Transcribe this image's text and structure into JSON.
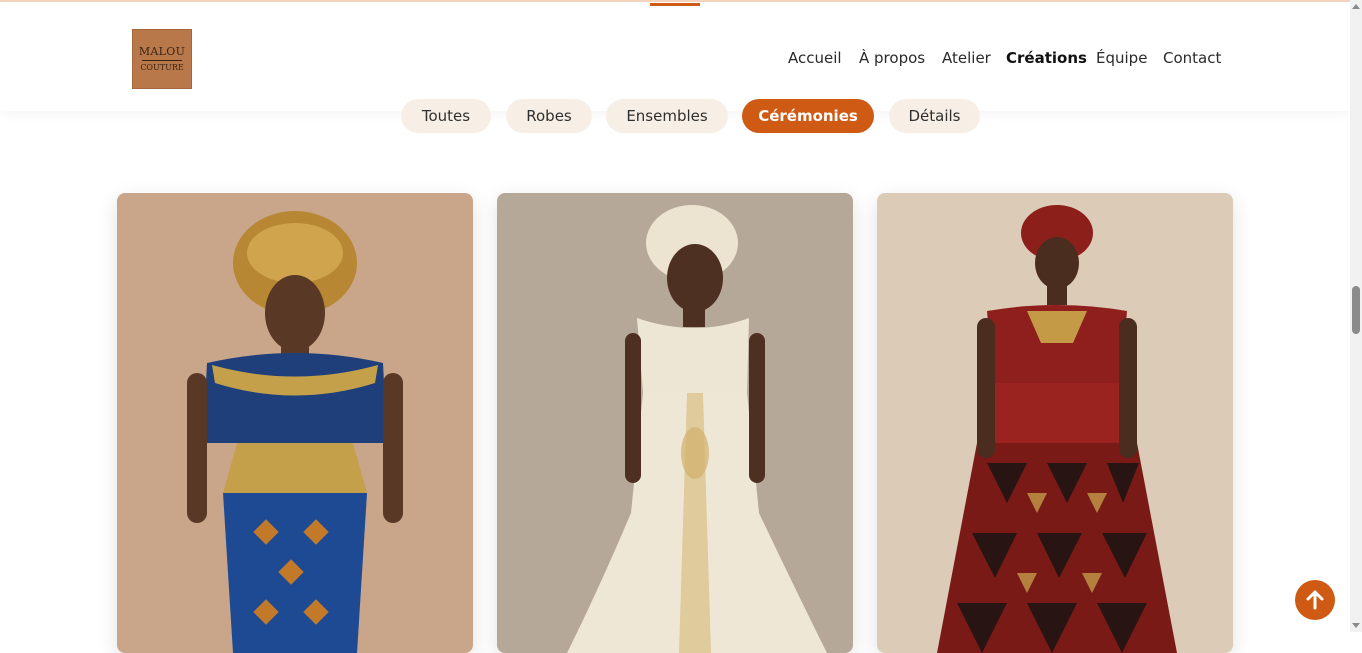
{
  "logo": {
    "line1": "MALOU",
    "line2": "COUTURE",
    "alt": "Malou Couture"
  },
  "nav": {
    "items": [
      {
        "label": "Accueil"
      },
      {
        "label": "À propos"
      },
      {
        "label": "Atelier"
      },
      {
        "label": "Créations",
        "active": true
      },
      {
        "label": "Équipe"
      },
      {
        "label": "Contact"
      }
    ]
  },
  "filters": {
    "items": [
      {
        "label": "Toutes"
      },
      {
        "label": "Robes"
      },
      {
        "label": "Ensembles"
      },
      {
        "label": "Cérémonies",
        "active": true
      },
      {
        "label": "Détails"
      }
    ]
  },
  "gallery": {
    "cards": [
      {
        "image": "woman-gold-gele-blue-gold-lace-dress"
      },
      {
        "image": "woman-ivory-gele-ivory-embroidered-gown"
      },
      {
        "image": "woman-red-headwrap-red-geometric-print-dress"
      }
    ]
  },
  "colors": {
    "accent": "#cf5a14",
    "pill_bg": "#f7efe5",
    "text": "#2a2a2a"
  },
  "icons": {
    "back_to_top": "arrow-up-icon"
  }
}
